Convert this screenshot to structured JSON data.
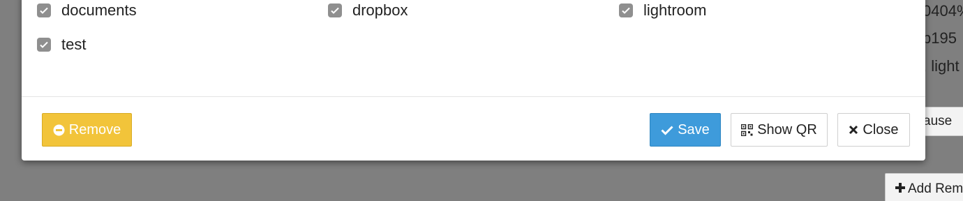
{
  "background": {
    "right_text": [
      "0404%",
      "b195",
      ", light"
    ],
    "pause_button_label": "ause",
    "add_button_label": "Add Rem"
  },
  "modal": {
    "folders": [
      {
        "label": "documents",
        "checked": true
      },
      {
        "label": "dropbox",
        "checked": true
      },
      {
        "label": "lightroom",
        "checked": true
      },
      {
        "label": "test",
        "checked": true
      }
    ],
    "footer": {
      "remove_label": "Remove",
      "save_label": "Save",
      "show_qr_label": "Show QR",
      "close_label": "Close"
    }
  },
  "colors": {
    "overlay": "#7f7f7f",
    "remove_button": "#f2c43a",
    "save_button": "#3e9bdb",
    "checkbox": "#8f8f8f"
  }
}
